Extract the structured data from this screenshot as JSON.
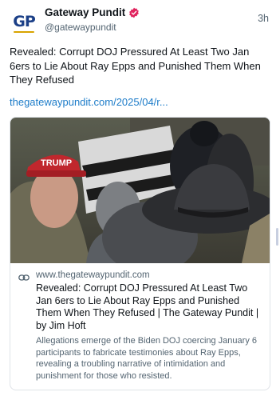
{
  "post": {
    "avatar_text": "GP",
    "display_name": "Gateway Pundit",
    "handle": "@gatewaypundit",
    "time": "3h",
    "text": "Revealed: Corrupt DOJ Pressured At Least Two Jan 6ers to Lie About Ray Epps and Punished Them When They Refused",
    "link": "thegatewaypundit.com/2025/04/r...",
    "verified_icon": "verified-badge-icon"
  },
  "card": {
    "domain": "www.thegatewaypundit.com",
    "title": "Revealed: Corrupt DOJ Pressured At Least Two Jan 6ers to Lie About Ray Epps and Punished Them When They Refused | The Gateway Pundit | by Jim Hoft",
    "description": "Allegations emerge of the Biden DOJ coercing January 6 participants to fabricate testimonies about Ray Epps, revealing a troubling narrative of intimidation and punishment for those who resisted.",
    "image_hat_text": "TRUMP",
    "link_icon": "link-icon"
  },
  "colors": {
    "link": "#1d7cc9",
    "verified": "#e0245e",
    "secondary_text": "#536471"
  }
}
